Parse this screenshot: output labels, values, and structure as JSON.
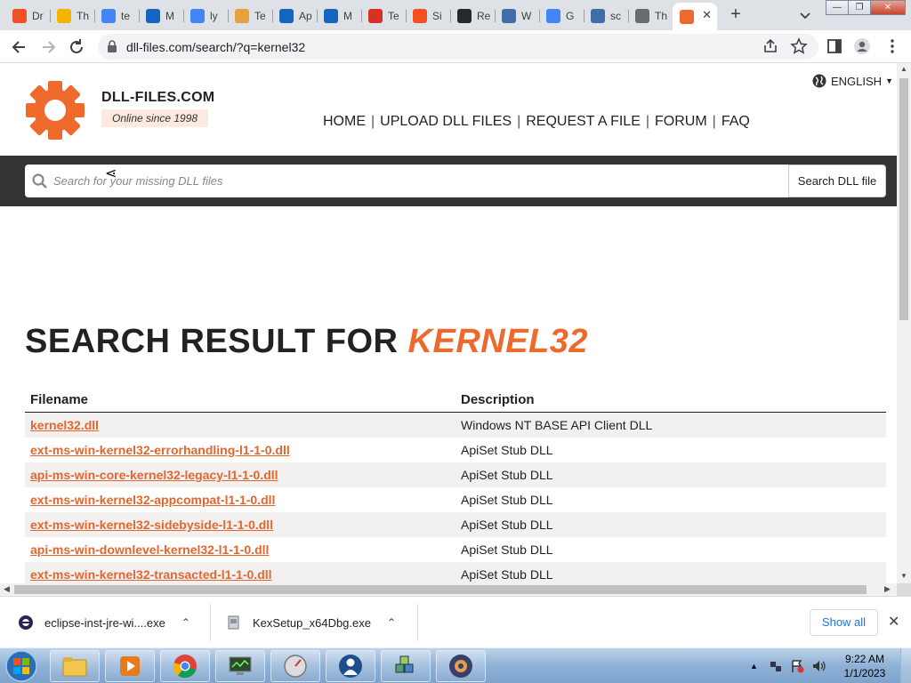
{
  "browser": {
    "tabs": [
      {
        "title": "Dr",
        "icon": "microsoft-icon",
        "color": "#f25022"
      },
      {
        "title": "Th",
        "icon": "hand-icon",
        "color": "#f4b400"
      },
      {
        "title": "te",
        "icon": "google-icon",
        "color": "#4285f4"
      },
      {
        "title": "M",
        "icon": "m-logo-icon",
        "color": "#1565c0"
      },
      {
        "title": "ly",
        "icon": "google-icon",
        "color": "#4285f4"
      },
      {
        "title": "Te",
        "icon": "character-icon",
        "color": "#e6a23c"
      },
      {
        "title": "Ap",
        "icon": "m-logo-icon",
        "color": "#1565c0"
      },
      {
        "title": "M",
        "icon": "m-logo-icon",
        "color": "#1565c0"
      },
      {
        "title": "Te",
        "icon": "mail-icon",
        "color": "#d93025"
      },
      {
        "title": "Si",
        "icon": "microsoft-icon",
        "color": "#f25022"
      },
      {
        "title": "Re",
        "icon": "github-icon",
        "color": "#24292e"
      },
      {
        "title": "W",
        "icon": "m-box-icon",
        "color": "#3f6ea8"
      },
      {
        "title": "G",
        "icon": "google-icon",
        "color": "#4285f4"
      },
      {
        "title": "sc",
        "icon": "m-box-icon",
        "color": "#3f6ea8"
      },
      {
        "title": "Th",
        "icon": "ef-icon",
        "color": "#6b6b6b"
      },
      {
        "title": "",
        "icon": "dll-files-gear-icon",
        "color": "#ee6a2c",
        "active": true
      }
    ],
    "new_tab": "+",
    "url": "dll-files.com/search/?q=kernel32"
  },
  "site": {
    "brand": "DLL-FILES.COM",
    "tagline": "Online since 1998",
    "language": "ENGLISH",
    "nav": [
      "HOME",
      "UPLOAD DLL FILES",
      "REQUEST A FILE",
      "FORUM",
      "FAQ"
    ],
    "search_placeholder": "Search for your missing DLL files",
    "search_button": "Search DLL file",
    "accent": "#ee6a2c"
  },
  "results": {
    "title_prefix": "SEARCH RESULT FOR",
    "query": "KERNEL32",
    "columns": [
      "Filename",
      "Description"
    ],
    "rows": [
      {
        "file": "kernel32.dll",
        "desc": "Windows NT BASE API Client DLL"
      },
      {
        "file": "ext-ms-win-kernel32-errorhandling-l1-1-0.dll",
        "desc": "ApiSet Stub DLL"
      },
      {
        "file": "api-ms-win-core-kernel32-legacy-l1-1-0.dll",
        "desc": "ApiSet Stub DLL"
      },
      {
        "file": "ext-ms-win-kernel32-appcompat-l1-1-0.dll",
        "desc": "ApiSet Stub DLL"
      },
      {
        "file": "ext-ms-win-kernel32-sidebyside-l1-1-0.dll",
        "desc": "ApiSet Stub DLL"
      },
      {
        "file": "api-ms-win-downlevel-kernel32-l1-1-0.dll",
        "desc": "ApiSet Stub DLL"
      },
      {
        "file": "ext-ms-win-kernel32-transacted-l1-1-0.dll",
        "desc": "ApiSet Stub DLL"
      }
    ]
  },
  "downloads": {
    "items": [
      "eclipse-inst-jre-wi....exe",
      "KexSetup_x64Dbg.exe"
    ],
    "show_all": "Show all"
  },
  "taskbar": {
    "time": "9:22 AM",
    "date": "1/1/2023"
  }
}
